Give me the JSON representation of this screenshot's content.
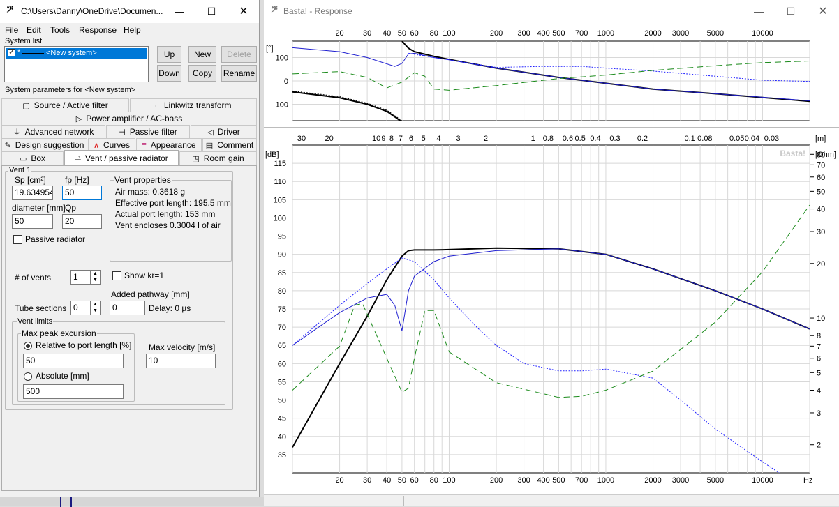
{
  "left_window": {
    "title": "C:\\Users\\Danny\\OneDrive\\Documen...",
    "app_glyph": "𝄢",
    "menu": [
      "File",
      "Edit",
      "Tools",
      "Response",
      "Help"
    ],
    "system_list": {
      "label": "System list",
      "item": "<New system>",
      "item_marker": "*",
      "checked": true,
      "buttons": {
        "up": "Up",
        "new": "New",
        "delete": "Delete",
        "down": "Down",
        "copy": "Copy",
        "rename": "Rename"
      }
    },
    "params_label": "System parameters for <New system>",
    "tabs": {
      "row1": [
        {
          "label": "Source / Active filter",
          "icon": "source-icon",
          "glyph": "▢"
        },
        {
          "label": "Linkwitz transform",
          "icon": "linkwitz-icon",
          "glyph": "⌐"
        }
      ],
      "row2": [
        {
          "label": "Power amplifier / AC-bass",
          "icon": "play-icon",
          "glyph": "▷"
        }
      ],
      "row3": [
        {
          "label": "Advanced network",
          "icon": "network-icon",
          "glyph": "⏚"
        },
        {
          "label": "Passive filter",
          "icon": "passive-filter-icon",
          "glyph": "⊣"
        },
        {
          "label": "Driver",
          "icon": "speaker-icon",
          "glyph": "◁"
        }
      ],
      "row4": [
        {
          "label": "Design suggestion",
          "icon": "pencil-icon",
          "glyph": "✎"
        },
        {
          "label": "Curves",
          "icon": "curves-icon",
          "glyph": "∧"
        },
        {
          "label": "Appearance",
          "icon": "appearance-icon",
          "glyph": "≡"
        },
        {
          "label": "Comment",
          "icon": "comment-icon",
          "glyph": "▤"
        }
      ],
      "row5": [
        {
          "label": "Box",
          "icon": "box-icon",
          "glyph": "▭"
        },
        {
          "label": "Vent / passive radiator",
          "icon": "vent-icon",
          "glyph": "⥬"
        },
        {
          "label": "Room gain",
          "icon": "room-icon",
          "glyph": "◳"
        }
      ]
    },
    "vent": {
      "group_label": "Vent 1",
      "sp_label": "Sp [cm²]",
      "sp_value": "19.634954",
      "fp_label": "fp [Hz]",
      "fp_value": "50",
      "diameter_label": "diameter [mm]",
      "diameter_value": "50",
      "qp_label": "Qp",
      "qp_value": "20",
      "passive_radiator_label": "Passive radiator",
      "passive_radiator_checked": false,
      "properties_label": "Vent properties",
      "properties": [
        "Air mass: 0.3618 g",
        "Effective port length: 195.5 mm",
        "Actual port length: 153 mm",
        "Vent encloses 0.3004 l of air"
      ],
      "num_vents_label": "# of vents",
      "num_vents_value": "1",
      "show_kr_label": "Show kr=1",
      "show_kr_checked": false,
      "added_pathway_label": "Added pathway [mm]",
      "added_pathway_value": "0",
      "delay_label": "Delay: 0 µs",
      "tube_sections_label": "Tube sections",
      "tube_sections_value": "0",
      "limits_label": "Vent limits",
      "max_peak_label": "Max peak excursion",
      "relative_label": "Relative to port length [%]",
      "relative_value": "50",
      "absolute_label": "Absolute [mm]",
      "absolute_value": "500",
      "max_velocity_label": "Max velocity [m/s]",
      "max_velocity_value": "10",
      "mode": "relative"
    }
  },
  "right_window": {
    "title": "Basta! - Response",
    "app_glyph": "𝄢",
    "watermark": "Basta!"
  },
  "chart_data": [
    {
      "type": "line",
      "name_printed": "",
      "x_scale": "log",
      "xlim": [
        10,
        20000
      ],
      "ylim": [
        -170,
        170
      ],
      "ylabel": "[°]",
      "x_tick_labels": [
        "20",
        "30",
        "40",
        "50",
        "60",
        "80",
        "100",
        "200",
        "300",
        "400",
        "500",
        "700",
        "1000",
        "2000",
        "3000",
        "5000",
        "10000"
      ],
      "x_tick_values": [
        20,
        30,
        40,
        50,
        60,
        80,
        100,
        200,
        300,
        400,
        500,
        700,
        1000,
        2000,
        3000,
        5000,
        10000
      ],
      "y_tick_labels": [
        "100",
        "0",
        "-100"
      ],
      "y_tick_values": [
        100,
        0,
        -100
      ],
      "grid": true,
      "series": [
        {
          "color": "#000000",
          "style": "solid",
          "x": [
            10,
            20,
            30,
            40,
            50
          ],
          "y": [
            -47,
            -72,
            -100,
            -130,
            -175
          ]
        },
        {
          "color": "#000000",
          "style": "dotted",
          "x": [
            10,
            20,
            30,
            40,
            50
          ],
          "y": [
            -43,
            -67,
            -95,
            -125,
            -170
          ]
        },
        {
          "color": "#000000",
          "style": "solid",
          "x": [
            50,
            55,
            60,
            80,
            100,
            200,
            500,
            1000,
            2000,
            5000,
            20000
          ],
          "y": [
            170,
            140,
            125,
            105,
            92,
            55,
            15,
            -10,
            -35,
            -55,
            -87
          ]
        },
        {
          "color": "#1f1fd0",
          "style": "solid",
          "x": [
            10,
            20,
            30,
            45,
            50,
            55,
            60,
            80,
            100,
            200,
            500,
            1000,
            2000,
            5000,
            20000
          ],
          "y": [
            142,
            125,
            100,
            62,
            75,
            115,
            118,
            100,
            90,
            55,
            15,
            -10,
            -35,
            -55,
            -85
          ]
        },
        {
          "color": "#2020ff",
          "style": "dotted",
          "x": [
            55,
            80,
            100,
            200,
            400,
            700,
            1000,
            2000,
            5000,
            10000,
            20000
          ],
          "y": [
            118,
            100,
            90,
            58,
            62,
            62,
            55,
            42,
            20,
            3,
            -2
          ]
        },
        {
          "color": "#1a8a1a",
          "style": "dashed",
          "x": [
            10,
            20,
            30,
            40,
            50,
            60,
            70,
            80,
            100,
            200,
            500,
            1000,
            2000,
            5000,
            10000,
            20000
          ],
          "y": [
            30,
            40,
            15,
            -30,
            -5,
            35,
            20,
            -35,
            -40,
            -20,
            10,
            25,
            45,
            65,
            78,
            85
          ]
        }
      ]
    },
    {
      "type": "line",
      "name_printed": "",
      "x_scale": "log",
      "xlim": [
        10,
        20000
      ],
      "ylim": [
        30,
        120
      ],
      "ylabel": "[dB]",
      "xlabel": "Hz",
      "y2label": "[Ohm]",
      "top_axis_label": "[m]",
      "top_axis_ticks": [
        "30",
        "20",
        "10",
        "9",
        "8",
        "7",
        "6",
        "5",
        "4",
        "3",
        "2",
        "1",
        "0.8",
        "0.6",
        "0.5",
        "0.4",
        "0.3",
        "0.2",
        "0.1",
        "0.08",
        "0.05",
        "0.04",
        "0.03"
      ],
      "top_axis_ticks_m": [
        30,
        20,
        10,
        9,
        8,
        7,
        6,
        5,
        4,
        3,
        2,
        1,
        0.8,
        0.6,
        0.5,
        0.4,
        0.3,
        0.2,
        0.1,
        0.08,
        0.05,
        0.04,
        0.03
      ],
      "x_tick_labels": [
        "20",
        "30",
        "40",
        "50",
        "60",
        "80",
        "100",
        "200",
        "300",
        "400",
        "500",
        "700",
        "1000",
        "2000",
        "3000",
        "5000",
        "10000"
      ],
      "x_tick_values": [
        20,
        30,
        40,
        50,
        60,
        80,
        100,
        200,
        300,
        400,
        500,
        700,
        1000,
        2000,
        3000,
        5000,
        10000
      ],
      "y_tick_labels": [
        "115",
        "110",
        "105",
        "100",
        "95",
        "90",
        "85",
        "80",
        "75",
        "70",
        "65",
        "60",
        "55",
        "50",
        "45",
        "40",
        "35"
      ],
      "y_tick_values": [
        115,
        110,
        105,
        100,
        95,
        90,
        85,
        80,
        75,
        70,
        65,
        60,
        55,
        50,
        45,
        40,
        35
      ],
      "y2_tick_labels": [
        "80",
        "70",
        "60",
        "50",
        "40",
        "30",
        "20",
        "10",
        "8",
        "7",
        "6",
        "5",
        "4",
        "3",
        "2"
      ],
      "y2_tick_values": [
        80,
        70,
        60,
        50,
        40,
        30,
        20,
        10,
        8,
        7,
        6,
        5,
        4,
        3,
        2
      ],
      "y2_scale": "log",
      "y2lim": [
        1.4,
        90
      ],
      "grid": true,
      "series": [
        {
          "color": "#000000",
          "style": "solid",
          "width": 2,
          "axis": "left",
          "x": [
            10,
            20,
            30,
            40,
            50,
            55,
            60,
            80,
            100,
            200,
            500,
            1000,
            2000,
            5000,
            10000,
            20000
          ],
          "y": [
            37,
            60,
            73,
            83,
            89.5,
            91,
            91.2,
            91.2,
            91.3,
            91.7,
            91.5,
            90,
            86,
            80,
            75,
            69.5
          ]
        },
        {
          "color": "#1f1fd0",
          "style": "solid",
          "width": 1,
          "axis": "left",
          "x": [
            10,
            20,
            30,
            40,
            45,
            50,
            55,
            60,
            80,
            100,
            200,
            500,
            1000,
            2000,
            5000,
            10000,
            20000
          ],
          "y": [
            65,
            74,
            78,
            79,
            76,
            69,
            80,
            84,
            88,
            89.5,
            91,
            91.5,
            90,
            86,
            80,
            75,
            69.5
          ]
        },
        {
          "color": "#2020ff",
          "style": "dotted",
          "width": 1,
          "axis": "left",
          "x": [
            10,
            20,
            30,
            40,
            50,
            60,
            80,
            100,
            150,
            200,
            300,
            500,
            700,
            1000,
            2000,
            3000,
            5000,
            10000,
            15000,
            20000
          ],
          "y": [
            65,
            76,
            82,
            86,
            89,
            88,
            83,
            78,
            70,
            65,
            60,
            58,
            58,
            58.5,
            56,
            50,
            42,
            33,
            28,
            27
          ]
        },
        {
          "color": "#1a8a1a",
          "style": "dashed",
          "width": 1,
          "axis": "right",
          "x": [
            10,
            20,
            25,
            28,
            30,
            40,
            50,
            55,
            60,
            70,
            80,
            100,
            200,
            500,
            700,
            1000,
            2000,
            5000,
            10000,
            20000
          ],
          "y": [
            4.0,
            7.0,
            11.8,
            12.0,
            10.5,
            6.0,
            3.9,
            4.1,
            6.0,
            11.0,
            11.0,
            6.5,
            4.4,
            3.65,
            3.7,
            4.0,
            5.1,
            9.5,
            18.0,
            42.0
          ]
        }
      ]
    }
  ]
}
